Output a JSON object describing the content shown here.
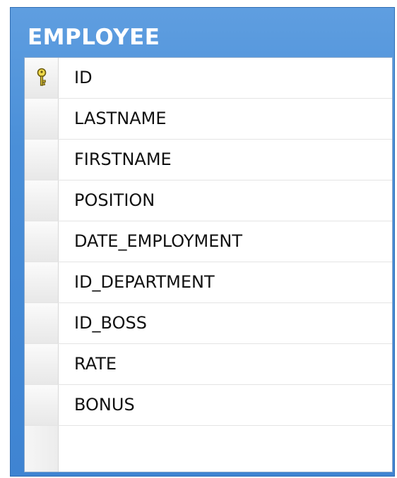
{
  "table": {
    "name": "EMPLOYEE",
    "columns": [
      {
        "name": "ID",
        "primary_key": true
      },
      {
        "name": "LASTNAME",
        "primary_key": false
      },
      {
        "name": "FIRSTNAME",
        "primary_key": false
      },
      {
        "name": "POSITION",
        "primary_key": false
      },
      {
        "name": "DATE_EMPLOYMENT",
        "primary_key": false
      },
      {
        "name": "ID_DEPARTMENT",
        "primary_key": false
      },
      {
        "name": "ID_BOSS",
        "primary_key": false
      },
      {
        "name": "RATE",
        "primary_key": false
      },
      {
        "name": "BONUS",
        "primary_key": false
      }
    ]
  },
  "icons": {
    "primary_key": "key-icon"
  },
  "colors": {
    "title_bar": "#4a8fd8",
    "title_text": "#ffffff",
    "key_icon": "#e8d23a"
  }
}
